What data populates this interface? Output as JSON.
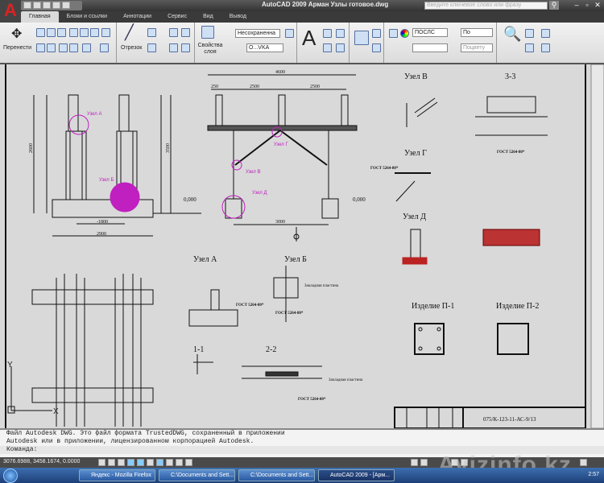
{
  "window": {
    "title": "AutoCAD 2009 Арман Узлы готовое.dwg",
    "search_placeholder": "Введите ключевое слово или фразу",
    "app_icon": "A"
  },
  "tabs": [
    {
      "label": "Главная",
      "active": true
    },
    {
      "label": "Блоки и ссылки"
    },
    {
      "label": "Аннотации"
    },
    {
      "label": "Сервис"
    },
    {
      "label": "Вид"
    },
    {
      "label": "Вывод"
    }
  ],
  "ribbon": {
    "move_label": "Перенести",
    "line_label": "Отрезок",
    "layer_props_label": "Свойства слоя",
    "layer_state": "Несохраненна",
    "layer_current": "О...VKA",
    "color": "ПОСЛС",
    "linetype": "По",
    "lineweight": "Поцвету"
  },
  "drawing": {
    "dims": {
      "d4600": "4600",
      "d2900": "2900",
      "d1800": "-1800",
      "d3000": "3000",
      "level1": "0,000",
      "level2": "0,000",
      "d2600": "2600",
      "d3500": "3500",
      "d2500a": "2500",
      "d2500b": "2500",
      "d250": "250"
    },
    "nodes_mag": {
      "a": "Узел А",
      "b": "Узел Б",
      "v": "Узел В",
      "g": "Узел Г",
      "d": "Узел Д"
    },
    "titles": {
      "uzel_v": "Узел В",
      "s33": "3-3",
      "uzel_g": "Узел Г",
      "uzel_d": "Узел Д",
      "uzel_a": "Узел А",
      "uzel_b": "Узел Б",
      "s11": "1-1",
      "s22": "2-2",
      "p1": "Изделие П-1",
      "p2": "Изделие П-2"
    },
    "notes": {
      "gost1": "ГОСТ 5264-80*",
      "gost2": "ГОСТ 5264-80*",
      "gost3": "ГОСТ 5264-80*",
      "gost4": "ГОСТ 5264-80*",
      "gost5": "ГОСТ 5264-80*",
      "plate1": "Закладная пластина",
      "plate2": "Закладная пластина"
    },
    "stamp_code": "075/К-123-11-АС-9/13",
    "axis_y": "Y",
    "axis_x": "X"
  },
  "command": {
    "line1": "Файл Autodesk DWG. Это файл формата TrustedDWG, сохраненный в приложении",
    "line2": "Autodesk или в приложении, лицензированном корпорацией Autodesk.",
    "prompt": "Команда:"
  },
  "status": {
    "coords": "3076.6988, 3458.1674, 0.0000"
  },
  "taskbar": {
    "items": [
      "Яндекс - Mozilla Firefox",
      "C:\\Documents and Sett...",
      "C:\\Documents and Sett...",
      "AutoCAD 2009 - [Арм..."
    ],
    "clock": "2:57"
  },
  "watermark": "Avizinfo.kz"
}
